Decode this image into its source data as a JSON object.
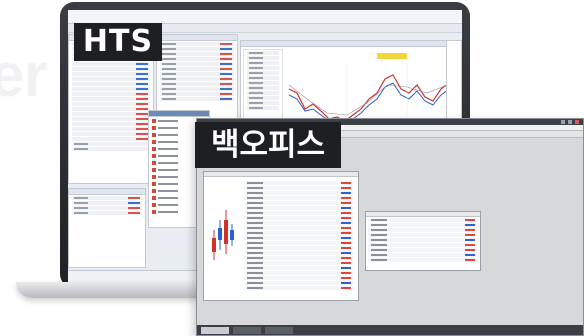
{
  "background_word": "er",
  "labels": {
    "hts": "HTS",
    "back_office": "백오피스"
  },
  "colors": {
    "badge_bg": "#1e1f23",
    "up": "#d9534f",
    "down": "#3b6fd1",
    "chart_candle_up": "#d0332b",
    "chart_candle_down": "#2c5fd0"
  }
}
